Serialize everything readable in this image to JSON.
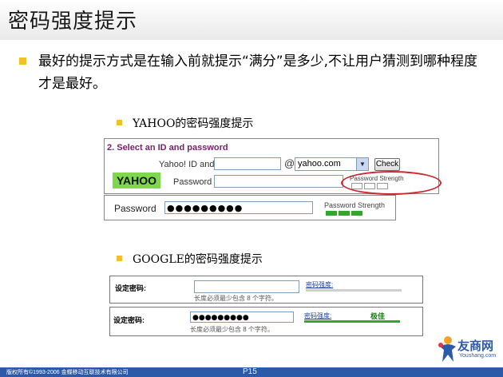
{
  "slide": {
    "title": "密码强度提示",
    "main_bullet": "最好的提示方式是在输入前就提示“满分”是多少,不让用户猜测到哪种程度才是最好。",
    "page": "P15",
    "footer_copyright": "版权所有©1993-2006 金蝶移动互联技术有限公司",
    "logo_text": "友商网",
    "logo_url": "Youshang.com"
  },
  "yahoo": {
    "heading": "YAHOO的密码强度提示",
    "form_title": "2. Select an ID and password",
    "id_label": "Yahoo! ID and Email",
    "at": "@",
    "domain_value": "yahoo.com",
    "check_label": "Check",
    "logo": "YAHOO",
    "password_label": "Password",
    "strength_label": "Password Strength",
    "filled_password_label": "Password",
    "filled_password_value": "●●●●●●●●●",
    "filled_strength_label": "Password Strength"
  },
  "google": {
    "heading": "GOOGLE的密码强度提示",
    "row1": {
      "label": "设定密码:",
      "value": "",
      "strength_link": "密码强度:",
      "hint": "长度必须最少包含 8 个字符。"
    },
    "row2": {
      "label": "设定密码:",
      "value": "●●●●●●●●●",
      "strength_link": "密码强度:",
      "rating": "极佳",
      "hint": "长度必须最少包含 8 个字符。"
    }
  },
  "colors": {
    "bullet": "#f2c029",
    "yahoo_title": "#7a1f6b",
    "strength_green": "#2ea82e",
    "highlight_ellipse": "#d0262d",
    "footer": "#2c5aa9"
  }
}
